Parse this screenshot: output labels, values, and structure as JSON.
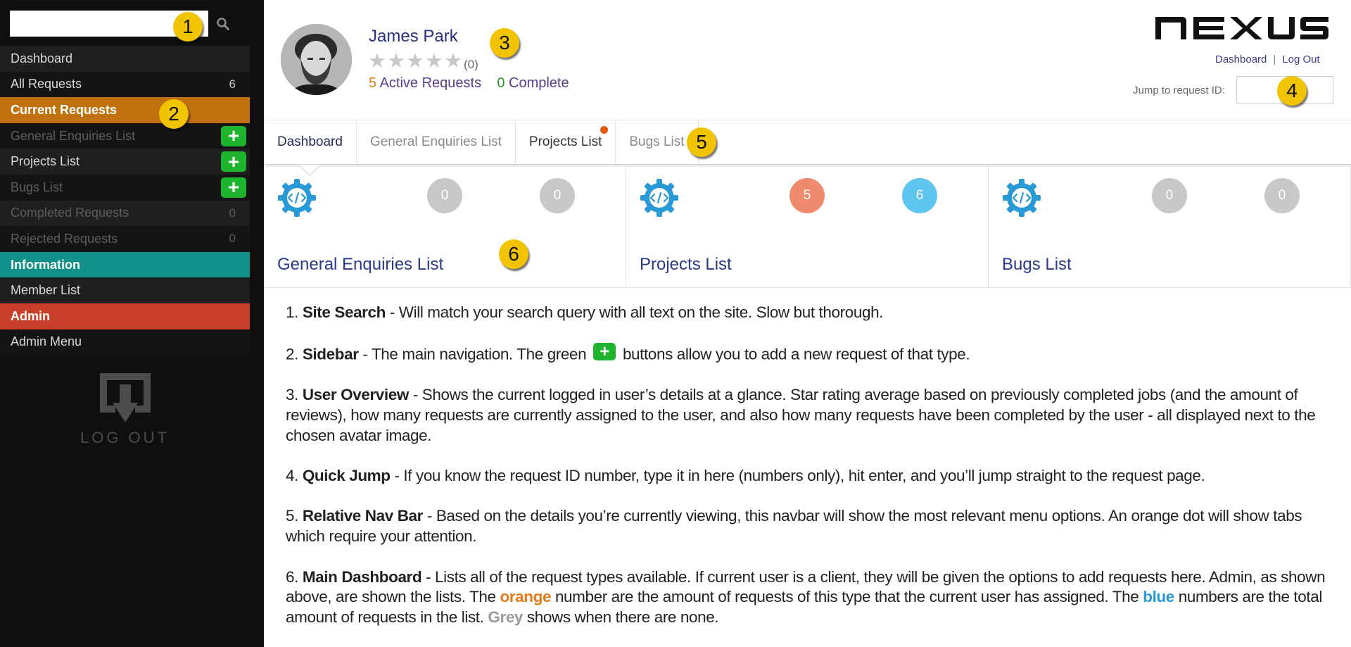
{
  "sidebar": {
    "search": {
      "value": "",
      "placeholder": ""
    },
    "items": [
      {
        "label": "Dashboard"
      },
      {
        "label": "All Requests",
        "count": "6"
      },
      {
        "label": "Current Requests"
      },
      {
        "label": "General Enquiries List",
        "add": "+"
      },
      {
        "label": "Projects List",
        "add": "+"
      },
      {
        "label": "Bugs List",
        "add": "+"
      },
      {
        "label": "Completed Requests",
        "count": "0"
      },
      {
        "label": "Rejected Requests",
        "count": "0"
      },
      {
        "label": "Information"
      },
      {
        "label": "Member List"
      },
      {
        "label": "Admin"
      },
      {
        "label": "Admin Menu"
      }
    ],
    "logout_label": "LOG OUT"
  },
  "user": {
    "name": "James Park",
    "stars": [
      "★",
      "★",
      "★",
      "★",
      "★"
    ],
    "rating": 0,
    "reviews": "(0)",
    "active_count": "5",
    "active_label": "Active Requests",
    "complete_count": "0",
    "complete_label": "Complete"
  },
  "header": {
    "logo": "NEXUS",
    "links": [
      "Dashboard",
      "|",
      "Log Out"
    ],
    "jump_label": "Jump to request ID:",
    "jump_value": ""
  },
  "tabs": [
    {
      "label": "Dashboard"
    },
    {
      "label": "General Enquiries List"
    },
    {
      "label": "Projects List"
    },
    {
      "label": "Bugs List"
    }
  ],
  "cards": [
    {
      "title": "General Enquiries List",
      "assigned": "0",
      "total": "0"
    },
    {
      "title": "Projects List",
      "assigned": "5",
      "total": "6"
    },
    {
      "title": "Bugs List",
      "assigned": "0",
      "total": "0"
    }
  ],
  "callouts": [
    "1",
    "2",
    "3",
    "4",
    "5",
    "6"
  ],
  "description": [
    {
      "num": "1. ",
      "title": "Site Search",
      "text": " - Will match your search query with all text on the site. Slow but thorough."
    },
    {
      "num": "2. ",
      "title": "Sidebar",
      "text_a": " - The main navigation. The green ",
      "icon": "+",
      "text_b": " buttons allow you to add a new request of that type."
    },
    {
      "num": "3. ",
      "title": "User Overview",
      "text": " - Shows the current logged in user’s details at a glance. Star rating average based on previously completed jobs (and the amount of reviews), how many requests are currently assigned to the user, and also how many requests have been completed by the user - all displayed next to the chosen avatar image."
    },
    {
      "num": "4. ",
      "title": "Quick Jump",
      "text": " - If you know the request ID number, type it in here (numbers only), hit enter, and you’ll jump straight to the request page."
    },
    {
      "num": "5. ",
      "title": "Relative Nav Bar",
      "text": " - Based on the details you’re currently viewing, this navbar will show the most relevant menu options. An orange dot will show tabs which require your attention."
    },
    {
      "num": "6. ",
      "title": "Main Dashboard",
      "text_a": " - Lists all of the request types available. If current user is a client, they will be given the options to add requests here. Admin, as shown above, are shown the lists. The ",
      "orange": "orange",
      "text_b": " number are the amount of requests of this type that the current user has assigned. The ",
      "blue": "blue",
      "text_c": " numbers are the total amount of requests in the list. ",
      "grey": "Grey",
      "text_d": " shows when there are none."
    }
  ],
  "colors": {
    "sidebar_bg": "#0f0f0f",
    "current_requests": "#c1720f",
    "information": "#12918b",
    "admin": "#c8402a",
    "add_green": "#1fb42e",
    "badge_orange": "#f08a6e",
    "badge_blue": "#5ec5ee",
    "badge_grey": "#c8c8c8",
    "gear_blue": "#2a9ad6",
    "callout_yellow": "#f2c400",
    "tab_dot": "#e05a10"
  }
}
